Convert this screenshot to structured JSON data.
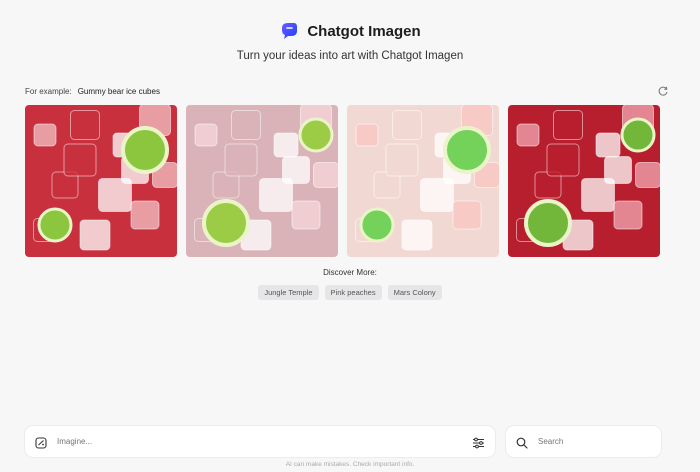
{
  "header": {
    "title": "Chatgot Imagen",
    "subtitle": "Turn your ideas into art with Chatgot Imagen"
  },
  "example": {
    "label": "For example:",
    "value": "Gummy bear ice cubes"
  },
  "gallery": [
    {
      "alt": "gummy-bear-ice-cubes-1",
      "bg": "#c8303d",
      "accent": "#f3c1c6",
      "lime": "#8cc63f"
    },
    {
      "alt": "gummy-bear-ice-cubes-2",
      "bg": "#d9b3b8",
      "accent": "#f6d5da",
      "lime": "#9ccc45"
    },
    {
      "alt": "gummy-bear-ice-cubes-3",
      "bg": "#f2d8d3",
      "accent": "#f9c6c0",
      "lime": "#74d15a"
    },
    {
      "alt": "gummy-bear-ice-cubes-4",
      "bg": "#b81f2e",
      "accent": "#f1a9b4",
      "lime": "#72b63a"
    }
  ],
  "discover": {
    "label": "Discover More:",
    "chips": [
      "Jungle Temple",
      "Pink peaches",
      "Mars Colony"
    ]
  },
  "prompt": {
    "placeholder": "Imagine..."
  },
  "search": {
    "placeholder": "Search"
  },
  "footer": {
    "disclaimer": "AI can make mistakes. Check important info."
  },
  "colors": {
    "logo": "#3d5afe",
    "background": "#f7f7f7"
  }
}
